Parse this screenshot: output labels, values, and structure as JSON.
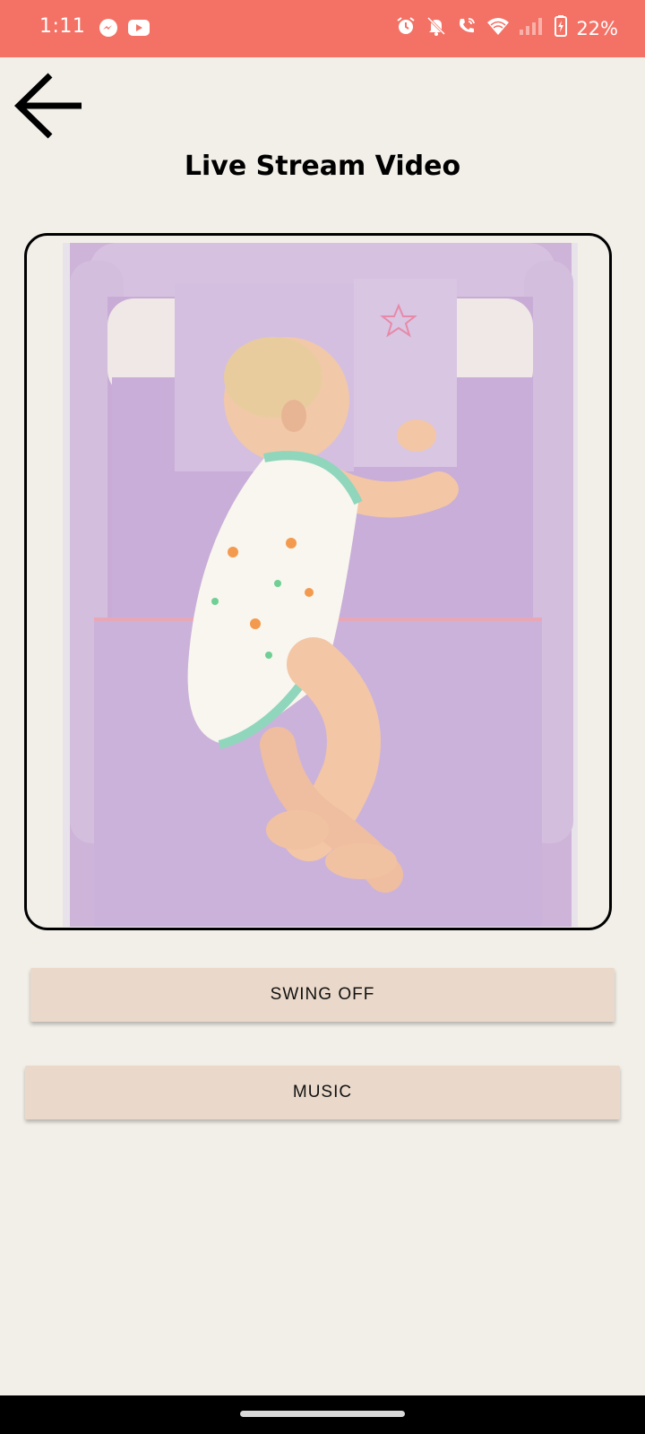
{
  "status_bar": {
    "time": "1:11",
    "battery": "22%",
    "background_color": "#f47165",
    "left_icons": [
      "messenger-icon",
      "youtube-icon"
    ],
    "right_icons": [
      "alarm-icon",
      "bell-off-icon",
      "wifi-calling-icon",
      "wifi-icon",
      "signal-icon",
      "battery-charging-icon"
    ]
  },
  "header": {
    "back_icon": "arrow-left-icon",
    "title": "Live Stream Video"
  },
  "video": {
    "content": "baby-sleeping-in-crib-image"
  },
  "controls": {
    "swing_label": "SWING OFF",
    "music_label": "MUSIC",
    "button_color": "#ead9ca"
  },
  "theme": {
    "background": "#f2efe8"
  }
}
